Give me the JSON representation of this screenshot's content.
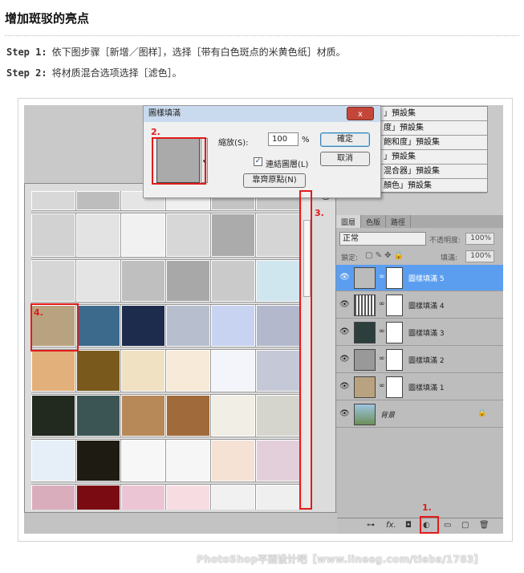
{
  "heading": "增加斑驳的亮点",
  "steps": [
    {
      "label": "Step 1:",
      "text": "依下图步骤［新增／图样］，选择［带有白色斑点的米黄色纸］材质。"
    },
    {
      "label": "Step 2:",
      "text": "将材质混合选项选择［滤色］。"
    }
  ],
  "presets_panel": {
    "items": [
      "」預設集",
      "度」預設集",
      "飽和度」預設集",
      "」預設集",
      "混合器」預設集",
      "顏色」預設集"
    ]
  },
  "dialog": {
    "title": "圖樣填滿",
    "close": "x",
    "scale_label": "縮放(S):",
    "scale_value": "100",
    "percent": "%",
    "link_label": "連結圖層(L)",
    "snap_button": "靠齊原點(N)",
    "ok": "確定",
    "cancel": "取消"
  },
  "layers_panel": {
    "tabs": [
      "圖層",
      "色版",
      "路徑"
    ],
    "blend_mode": "正常",
    "opacity_label": "不透明度:",
    "opacity_value": "100%",
    "lock_label": "鎖定:",
    "fill_label": "填滿:",
    "fill_value": "100%",
    "layers": [
      "圖樣填滿 5",
      "圖樣填滿 4",
      "圖樣填滿 3",
      "圖樣填滿 2",
      "圖樣填滿 1",
      "背景"
    ]
  },
  "annotations": {
    "a1": "1.",
    "a2": "2.",
    "a3": "3.",
    "a4": "4."
  },
  "watermark": "PhotoShop平面设计吧【www.lineeg.com/tieba/1783】",
  "swatch_colors": [
    "#d8d8d8",
    "#bdbdbd",
    "#e5e5e5",
    "#f0f0f0",
    "#c4c4c4",
    "#c8c8c8",
    "#d2d2d2",
    "#e3e3e3",
    "#f1f1f1",
    "#d7d7d7",
    "#ababab",
    "#d5d5d5",
    "#d6d6d6",
    "#e4e4e4",
    "#bfbfbf",
    "#a8a8a8",
    "#cacaca",
    "#cfe6ef",
    "#b9a27f",
    "#3c6a8c",
    "#1d2c4d",
    "#b7bfcf",
    "#c8d3f2",
    "#b3b8cc",
    "#e2b07a",
    "#7a5a1c",
    "#f0e1c2",
    "#f8ead8",
    "#f4f5fa",
    "#c5c8d6",
    "#22291f",
    "#3b5555",
    "#b78858",
    "#a06a3a",
    "#f1eee5",
    "#d6d5cd",
    "#e6eef8",
    "#1e1c12",
    "#f7f7f7",
    "#f6f6f6",
    "#f5e2d5",
    "#e3cfd9",
    "#d9adbc",
    "#7a0b12",
    "#ecc5d4",
    "#f7dde2",
    "#f1f1f1",
    "#efefef"
  ]
}
